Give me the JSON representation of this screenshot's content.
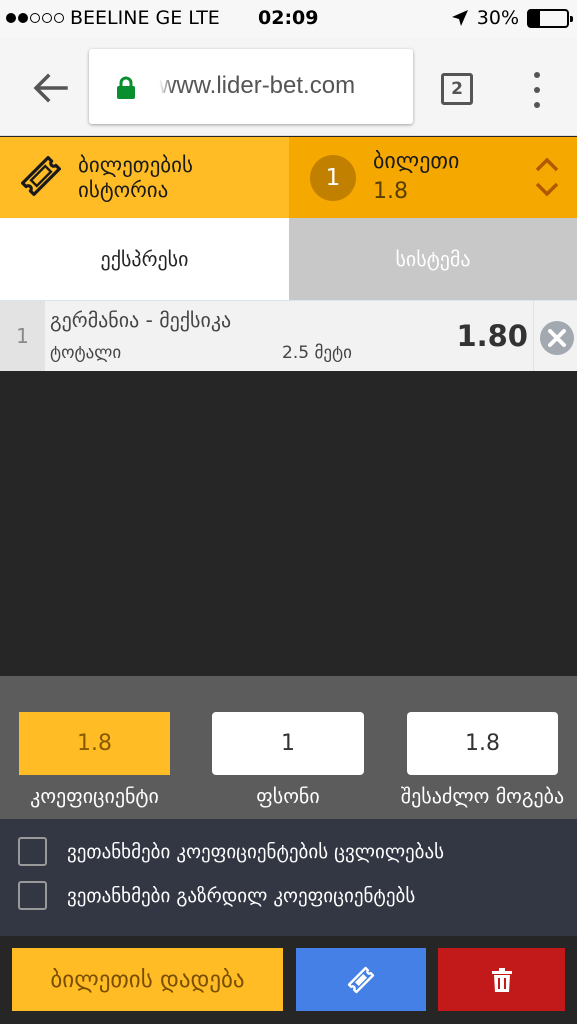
{
  "status_bar": {
    "carrier": "BEELINE GE",
    "network": "LTE",
    "time": "02:09",
    "battery": "30%",
    "battery_level": 0.3,
    "signal_bars_filled": 2,
    "signal_bars_total": 5
  },
  "browser": {
    "url": "www.lider-bet.com",
    "tab_count": "2"
  },
  "header": {
    "history_label": "ბილეთების ისტორია",
    "ticket_title": "ბილეთი",
    "ticket_count": "1",
    "ticket_odds": "1.8"
  },
  "tabs": [
    {
      "label": "ექსპრესი",
      "active": true
    },
    {
      "label": "სისტემა",
      "active": false
    }
  ],
  "bets": [
    {
      "number": "1",
      "match": "გერმანია - მექსიკა",
      "market": "ტოტალი",
      "outcome": "2.5 მეტი",
      "odds": "1.80"
    }
  ],
  "summary": {
    "odds_value": "1.8",
    "odds_label": "კოეფიციენტი",
    "stake_value": "1",
    "stake_label": "ფსონი",
    "win_value": "1.8",
    "win_label": "შესაძლო მოგება"
  },
  "agreements": [
    {
      "label": "ვეთანხმები კოეფიციენტების ცვლილებას",
      "checked": false
    },
    {
      "label": "ვეთანხმები გაზრდილ კოეფიციენტებს",
      "checked": false
    }
  ],
  "actions": {
    "place_bet_label": "ბილეთის დადება"
  },
  "colors": {
    "accent_yellow": "#ffbc24",
    "accent_orange": "#f5a800",
    "coupon_blue": "#4580e6",
    "delete_red": "#c21a1a"
  }
}
